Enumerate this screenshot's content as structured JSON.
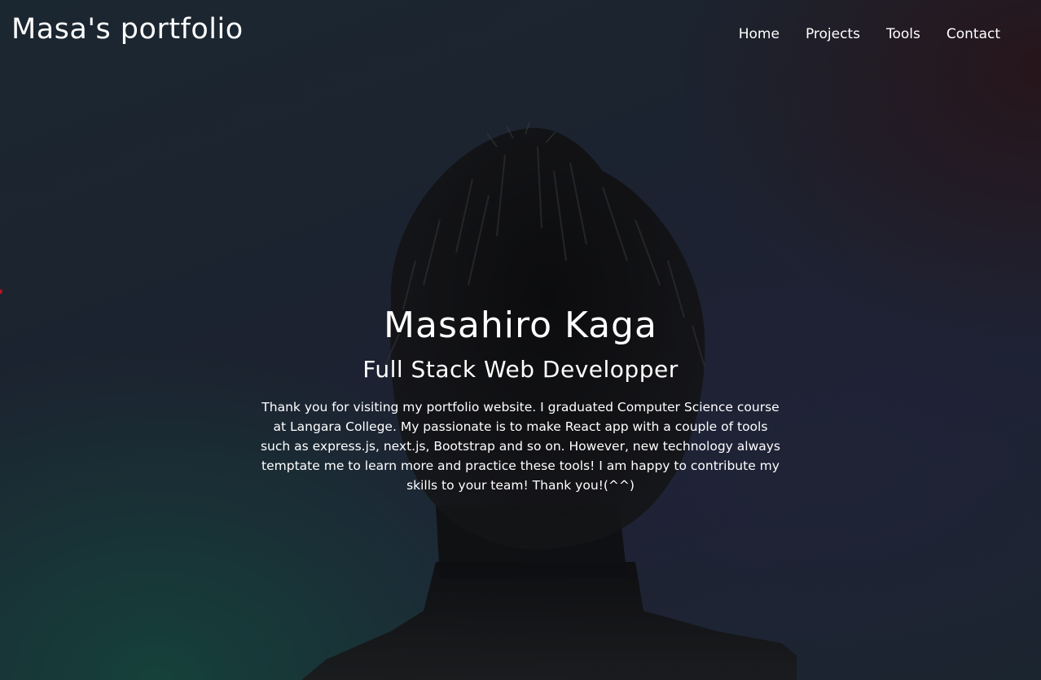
{
  "header": {
    "logo": "Masa's portfolio",
    "nav": [
      "Home",
      "Projects",
      "Tools",
      "Contact"
    ]
  },
  "hero": {
    "name": "Masahiro Kaga",
    "role": "Full Stack Web Developper",
    "bio": "Thank you for visiting my portfolio website. I graduated Computer Science course at Langara College. My passionate is to make React app with a couple of tools such as express.js, next.js, Bootstrap and so on. However, new technology always temptate me to learn more and practice these tools! I am happy to contribute my skills to your team! Thank you!(^^)"
  },
  "colors": {
    "accent_dot": "#b4161e",
    "text": "#ffffff"
  }
}
